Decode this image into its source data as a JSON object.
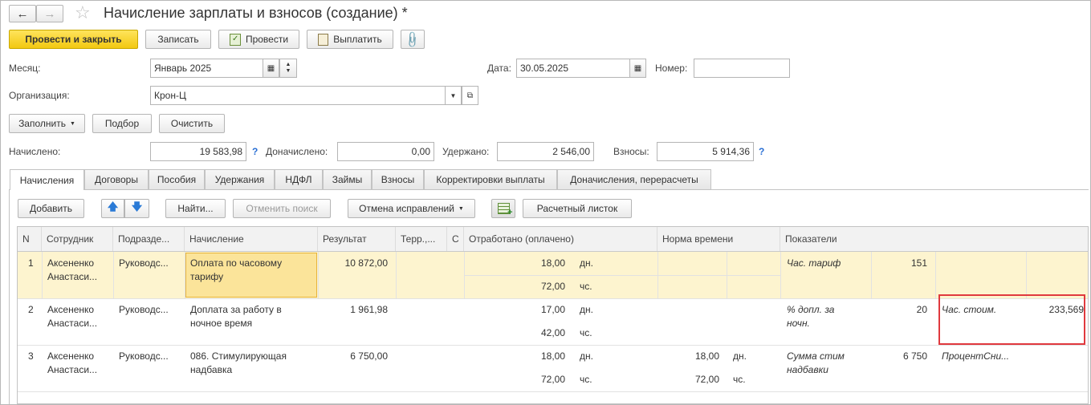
{
  "window": {
    "title": "Начисление зарплаты и взносов (создание) *"
  },
  "toolbar": {
    "post_close": "Провести и закрыть",
    "save": "Записать",
    "post": "Провести",
    "pay": "Выплатить"
  },
  "form": {
    "month_label": "Месяц:",
    "month_value": "Январь 2025",
    "date_label": "Дата:",
    "date_value": "30.05.2025",
    "number_label": "Номер:",
    "number_value": "",
    "org_label": "Организация:",
    "org_value": "Крон-Ц"
  },
  "actions": {
    "fill": "Заполнить",
    "select": "Подбор",
    "clear": "Очистить"
  },
  "totals": {
    "accrued_label": "Начислено:",
    "accrued_value": "19 583,98",
    "extra_label": "Доначислено:",
    "extra_value": "0,00",
    "withheld_label": "Удержано:",
    "withheld_value": "2 546,00",
    "contrib_label": "Взносы:",
    "contrib_value": "5 914,36",
    "help": "?"
  },
  "tabs": [
    "Начисления",
    "Договоры",
    "Пособия",
    "Удержания",
    "НДФЛ",
    "Займы",
    "Взносы",
    "Корректировки выплаты",
    "Доначисления, перерасчеты"
  ],
  "grid_toolbar": {
    "add": "Добавить",
    "find": "Найти...",
    "cancel_search": "Отменить поиск",
    "undo_corrections": "Отмена исправлений",
    "payslip": "Расчетный листок"
  },
  "columns": {
    "n": "N",
    "employee": "Сотрудник",
    "department": "Подразде...",
    "accrual": "Начисление",
    "result": "Результат",
    "territory": "Терр.,...",
    "c": "С",
    "worked": "Отработано (оплачено)",
    "norm": "Норма времени",
    "indicators": "Показатели"
  },
  "rows": [
    {
      "n": "1",
      "emp1": "Аксененко",
      "emp2": "Анастаси...",
      "dept": "Руководс...",
      "acc1": "Оплата по часовому",
      "acc2": "тарифу",
      "result": "10 872,00",
      "w_days": "18,00",
      "w_days_u": "дн.",
      "w_hours": "72,00",
      "w_hours_u": "чс.",
      "n_days": "",
      "n_days_u": "",
      "n_hours": "",
      "n_hours_u": "",
      "ind1_name1": "Час. тариф",
      "ind1_name2": "",
      "ind1_val": "151",
      "ind2_name": "",
      "ind2_val": ""
    },
    {
      "n": "2",
      "emp1": "Аксененко",
      "emp2": "Анастаси...",
      "dept": "Руководс...",
      "acc1": "Доплата за работу в",
      "acc2": "ночное время",
      "result": "1 961,98",
      "w_days": "17,00",
      "w_days_u": "дн.",
      "w_hours": "42,00",
      "w_hours_u": "чс.",
      "n_days": "",
      "n_days_u": "",
      "n_hours": "",
      "n_hours_u": "",
      "ind1_name1": "% допл. за",
      "ind1_name2": "ночн.",
      "ind1_val": "20",
      "ind2_name": "Час. стоим.",
      "ind2_val": "233,569"
    },
    {
      "n": "3",
      "emp1": "Аксененко",
      "emp2": "Анастаси...",
      "dept": "Руководс...",
      "acc1": "086. Стимулирующая",
      "acc2": "надбавка",
      "result": "6 750,00",
      "w_days": "18,00",
      "w_days_u": "дн.",
      "w_hours": "72,00",
      "w_hours_u": "чс.",
      "n_days": "18,00",
      "n_days_u": "дн.",
      "n_hours": "72,00",
      "n_hours_u": "чс.",
      "ind1_name1": "Сумма стим",
      "ind1_name2": "надбавки",
      "ind1_val": "6 750",
      "ind2_name": "ПроцентСни...",
      "ind2_val": ""
    }
  ],
  "colors": {
    "accent": "#f2c811",
    "selected_row": "#fdf4cf",
    "selected_cell": "#fbe49a",
    "highlight": "#e0393e"
  }
}
